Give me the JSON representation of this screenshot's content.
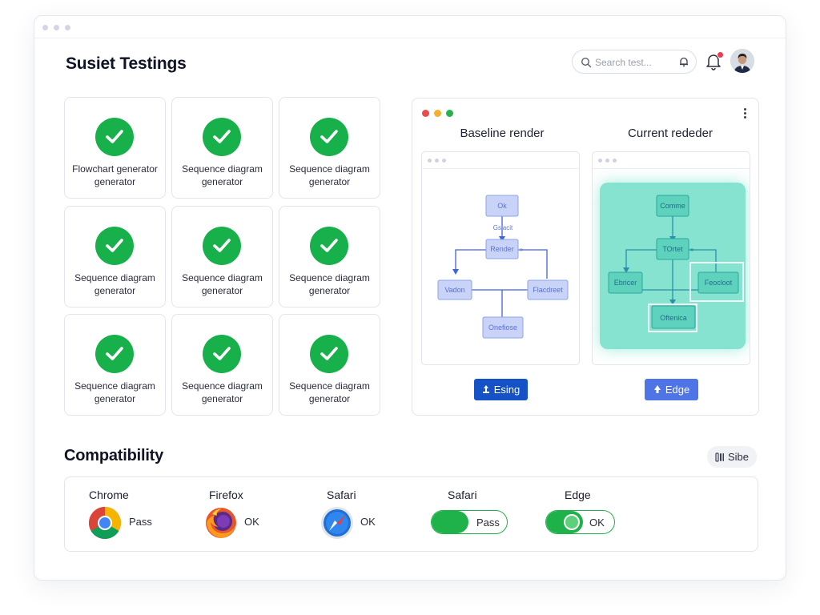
{
  "app": {
    "title": "Susiet Testings",
    "search_placeholder": "Search test..."
  },
  "tests": [
    {
      "label": "Flowchart generator generator",
      "status": "pass"
    },
    {
      "label": "Sequence diagram generator",
      "status": "pass"
    },
    {
      "label": "Sequence diagram generator",
      "status": "pass"
    },
    {
      "label": "Sequence diagram generator",
      "status": "pass"
    },
    {
      "label": "Sequence diagram generator",
      "status": "pass"
    },
    {
      "label": "Sequence diagram generator",
      "status": "pass"
    },
    {
      "label": "Sequence diagram generator",
      "status": "pass"
    },
    {
      "label": "Sequence diagram generator",
      "status": "pass"
    },
    {
      "label": "Sequence diagram generator",
      "status": "pass"
    }
  ],
  "comparison": {
    "baseline": {
      "title": "Baseline render",
      "nodes": {
        "top": "Ok",
        "center": "Render",
        "left": "Vadon",
        "right": "Flacdreet",
        "bottom": "Onefiose"
      },
      "edge_label": "Gslacit",
      "button_label": "Esing"
    },
    "current": {
      "title": "Current rededer",
      "nodes": {
        "top": "Comme",
        "center": "TOrtet",
        "left": "Ebricer",
        "right": "Feocloot",
        "bottom": "Oftenica"
      },
      "button_label": "Edge"
    }
  },
  "compatibility": {
    "title": "Compatibility",
    "side_button_label": "Sibe",
    "browsers": [
      {
        "name": "Chrome",
        "status": "Pass",
        "logo": "chrome-logo"
      },
      {
        "name": "Firefox",
        "status": "OK",
        "logo": "firefox-logo"
      },
      {
        "name": "Safari",
        "status": "OK",
        "logo": "safari-logo"
      },
      {
        "name": "Safari",
        "status": "Pass",
        "control": "toggle"
      },
      {
        "name": "Edge",
        "status": "OK",
        "control": "toggle"
      }
    ]
  },
  "colors": {
    "pass_green": "#17b04a",
    "baseline_button": "#1552c6",
    "current_button": "#4e74e6",
    "current_highlight": "#86e3cf",
    "baseline_node": "#c9d3f7"
  }
}
